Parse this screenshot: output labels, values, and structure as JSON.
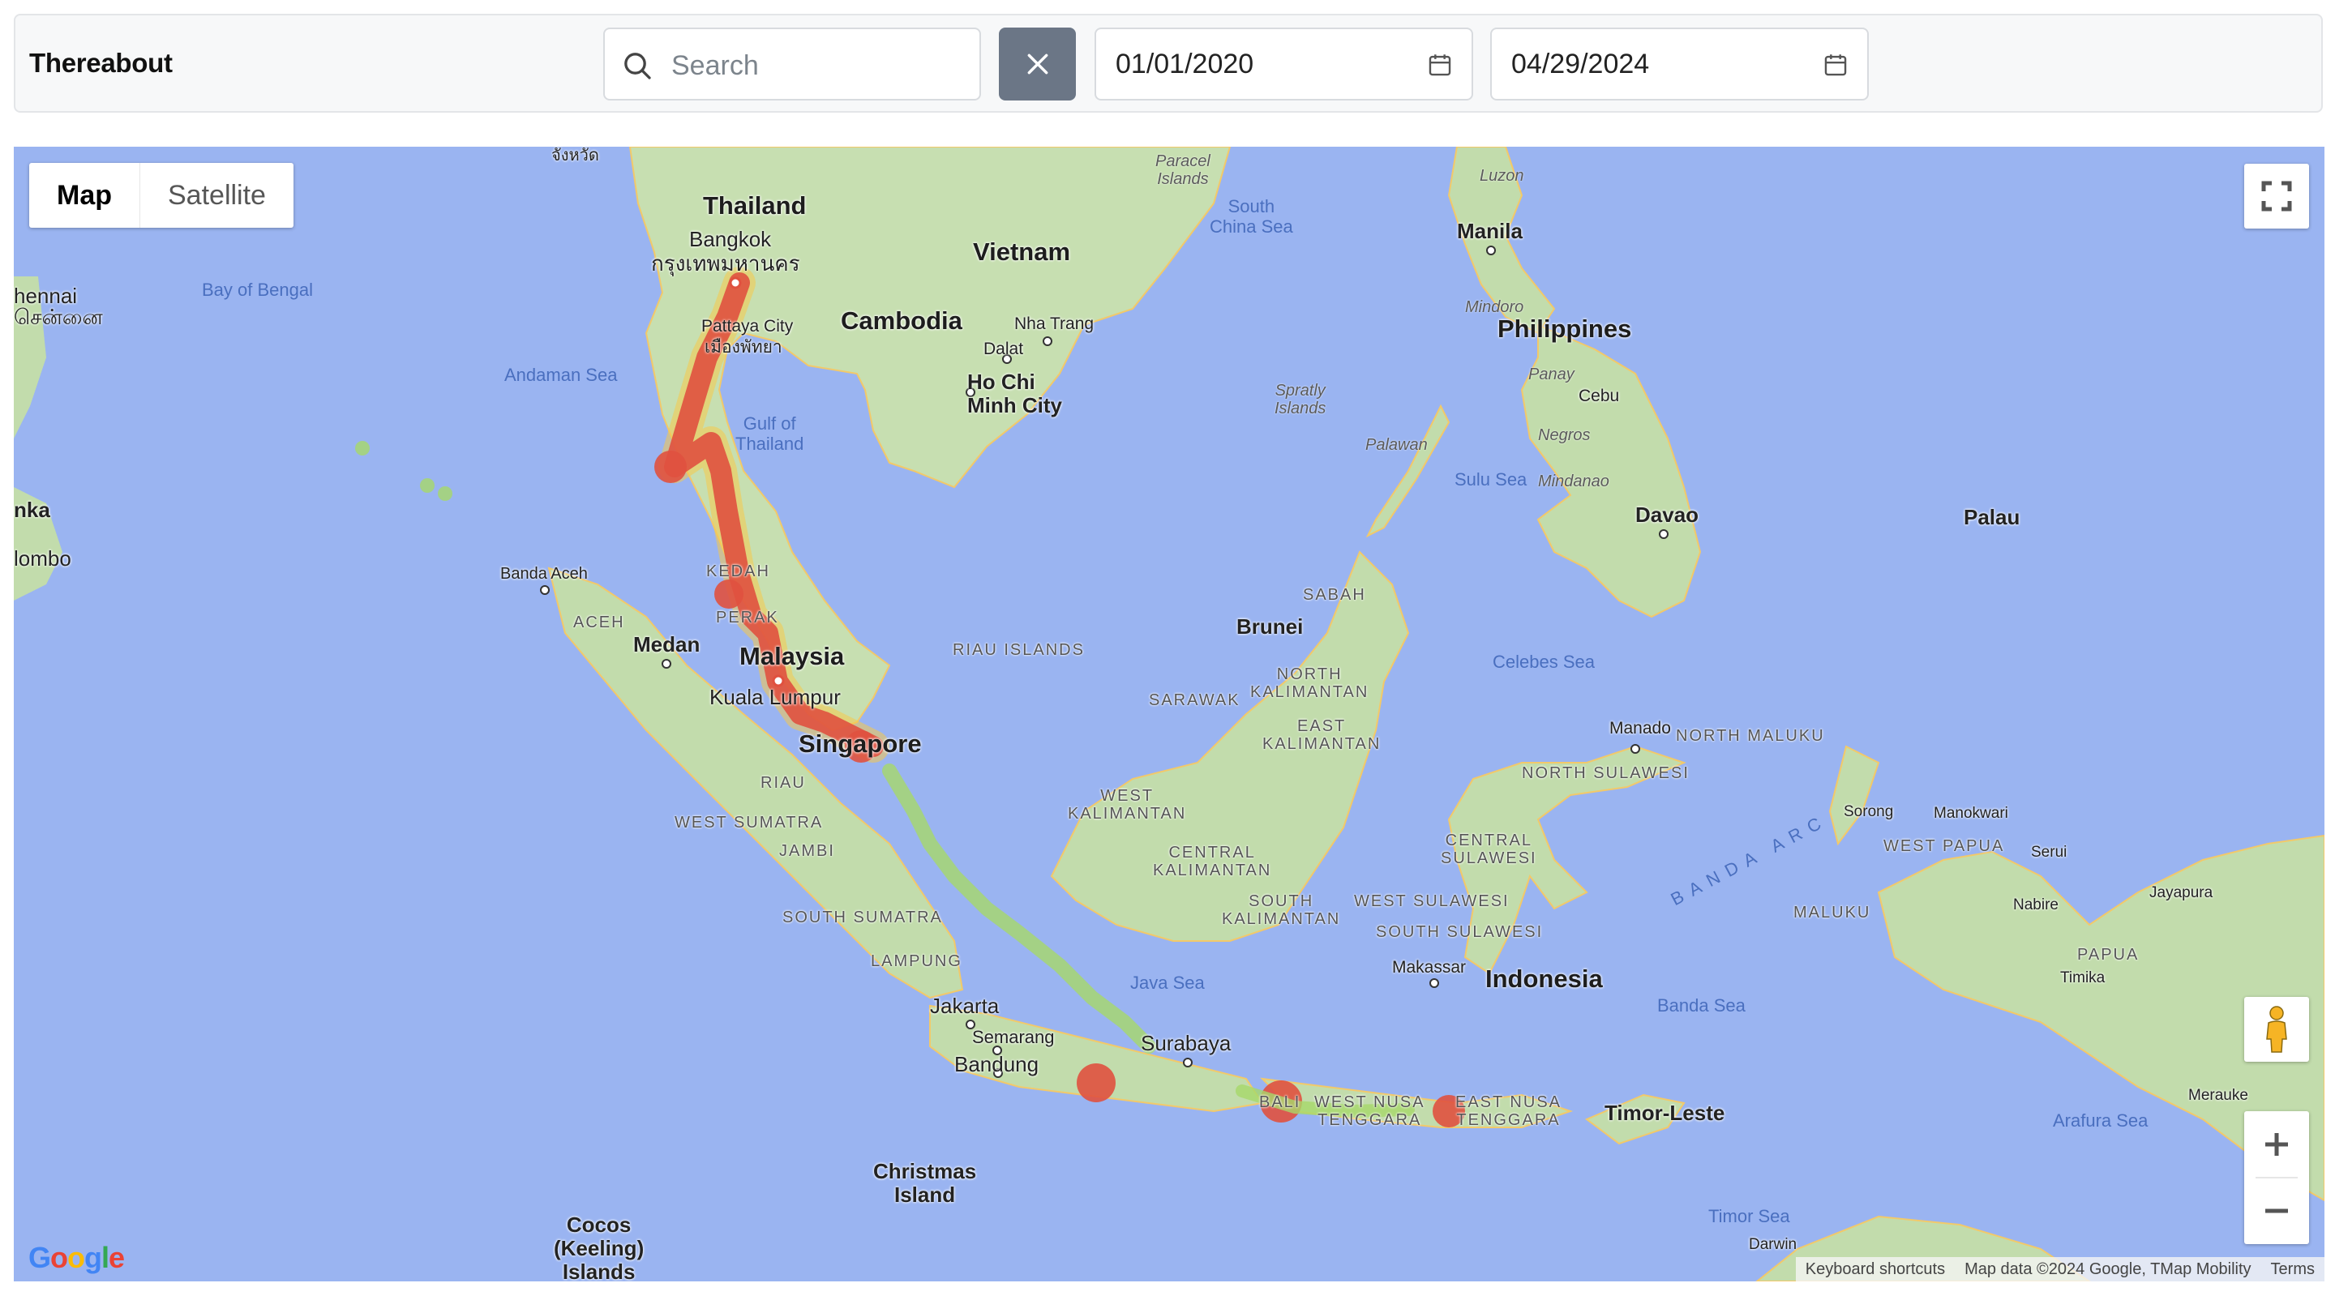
{
  "app": {
    "title": "Thereabout"
  },
  "search": {
    "placeholder": "Search",
    "value": ""
  },
  "date_range": {
    "start": "01/01/2020",
    "end": "04/29/2024"
  },
  "map": {
    "map_type": {
      "active": "Map",
      "inactive": "Satellite"
    },
    "countries": {
      "thailand": "Thailand",
      "vietnam": "Vietnam",
      "cambodia": "Cambodia",
      "malaysia": "Malaysia",
      "philippines": "Philippines",
      "indonesia": "Indonesia",
      "brunei": "Brunei",
      "timor_leste": "Timor-Leste",
      "palau": "Palau",
      "singapore": "Singapore",
      "sri_lanka_partial": "nka"
    },
    "cities": {
      "bangkok": "Bangkok",
      "bangkok_thai": "กรุงเทพมหานคร",
      "pattaya": "Pattaya City",
      "pattaya_thai": "เมืองพัทยา",
      "nha_trang": "Nha Trang",
      "dalat": "Dalat",
      "ho_chi_minh": "Ho Chi\nMinh City",
      "manila": "Manila",
      "cebu": "Cebu",
      "davao": "Davao",
      "medan": "Medan",
      "banda_aceh": "Banda Aceh",
      "kuala_lumpur": "Kuala Lumpur",
      "jakarta": "Jakarta",
      "semarang": "Semarang",
      "bandung": "Bandung",
      "surabaya": "Surabaya",
      "makassar": "Makassar",
      "manado": "Manado",
      "sorong": "Sorong",
      "manokwari": "Manokwari",
      "nabire": "Nabire",
      "jayapura": "Jayapura",
      "timika": "Timika",
      "merauke": "Merauke",
      "darwin": "Darwin",
      "serui": "Serui",
      "chennai_partial": "hennai",
      "chennai_tamil": "சென்னை",
      "colombo_partial": "lombo",
      "north_top": "จังหวัด"
    },
    "regions": {
      "sabah": "SABAH",
      "sarawak": "SARAWAK",
      "north_kalimantan": "NORTH\nKALIMANTAN",
      "east_kalimantan": "EAST\nKALIMANTAN",
      "west_kalimantan": "WEST\nKALIMANTAN",
      "central_kalimantan": "CENTRAL\nKALIMANTAN",
      "south_kalimantan": "SOUTH\nKALIMANTAN",
      "aceh": "ACEH",
      "kedah": "KEDAH",
      "perak": "PERAK",
      "riau": "RIAU",
      "riau_islands": "RIAU ISLANDS",
      "west_sumatra": "WEST SUMATRA",
      "jambi": "JAMBI",
      "south_sumatra": "SOUTH SUMATRA",
      "lampung": "LAMPUNG",
      "west_sulawesi": "WEST SULAWESI",
      "south_sulawesi": "SOUTH SULAWESI",
      "central_sulawesi": "CENTRAL\nSULAWESI",
      "north_sulawesi": "NORTH SULAWESI",
      "north_maluku": "NORTH MALUKU",
      "maluku": "MALUKU",
      "west_papua": "WEST PAPUA",
      "papua": "PAPUA",
      "bali": "BALI",
      "west_nusa_tenggara": "WEST NUSA\nTENGGARA",
      "east_nusa_tenggara": "EAST NUSA\nTENGGARA"
    },
    "water": {
      "bay_of_bengal": "Bay of Bengal",
      "andaman_sea": "Andaman Sea",
      "gulf_of_thailand": "Gulf of\nThailand",
      "south_china_sea": "South\nChina Sea",
      "sulu_sea": "Sulu Sea",
      "celebes_sea": "Celebes Sea",
      "java_sea": "Java Sea",
      "banda_sea": "Banda Sea",
      "arafura_sea": "Arafura Sea",
      "timor_sea": "Timor Sea",
      "banda_arc": "BANDA ARC"
    },
    "islands": {
      "paracel": "Paracel\nIslands",
      "spratly": "Spratly\nIslands",
      "luzon": "Luzon",
      "mindoro": "Mindoro",
      "panay": "Panay",
      "negros": "Negros",
      "mindanao": "Mindanao",
      "palawan": "Palawan",
      "christmas": "Christmas\nIsland",
      "cocos": "Cocos\n(Keeling)\nIslands"
    },
    "footer": {
      "keyboard": "Keyboard shortcuts",
      "data": "Map data ©2024 Google, TMap Mobility",
      "terms": "Terms"
    },
    "logo": "Google"
  }
}
